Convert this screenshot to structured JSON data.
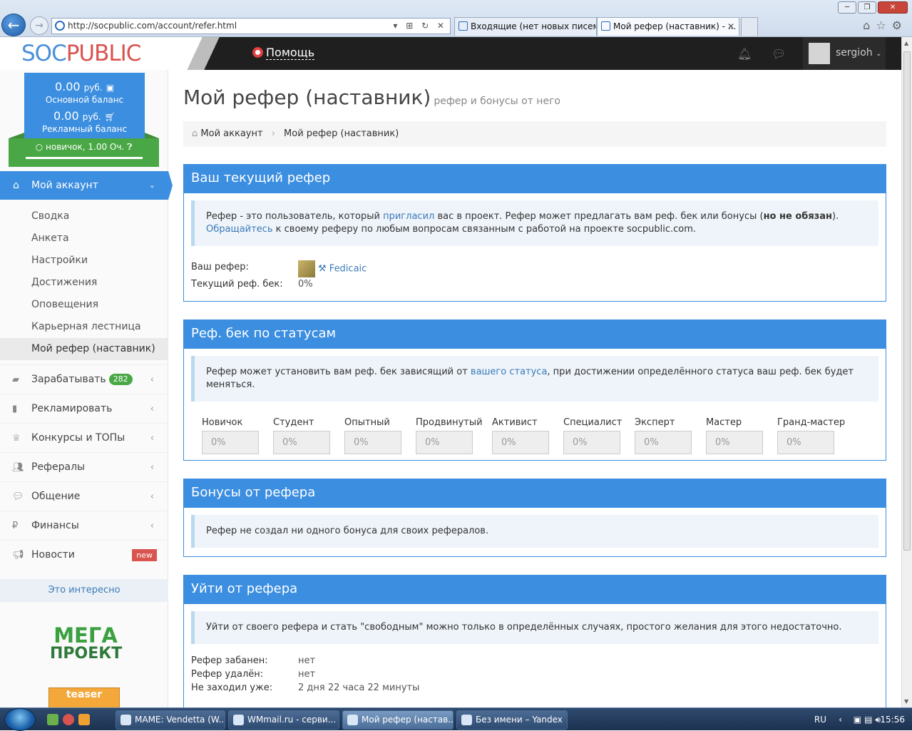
{
  "browser": {
    "url": "http://socpublic.com/account/refer.html",
    "tabs": [
      {
        "label": "Входящие (нет новых писем)..."
      },
      {
        "label": "Мой рефер (наставник) - ..."
      }
    ]
  },
  "topbar": {
    "logo_left": "SOC",
    "logo_right": "PUBLIC",
    "help": "Помощь",
    "username": "sergioh"
  },
  "sidebar": {
    "main_balance": "0.00",
    "currency": "руб.",
    "main_balance_label": "Основной баланс",
    "ad_balance": "0.00",
    "ad_balance_label": "Рекламный баланс",
    "rank": "новичок, 1.00 Оч.",
    "account_menu": "Мой аккаунт",
    "sub_items": [
      "Сводка",
      "Анкета",
      "Настройки",
      "Достижения",
      "Оповещения",
      "Карьерная лестница",
      "Мой рефер (наставник)"
    ],
    "menu": [
      {
        "label": "Зарабатывать",
        "badge": "282"
      },
      {
        "label": "Рекламировать"
      },
      {
        "label": "Конкурсы и ТОПы"
      },
      {
        "label": "Рефералы"
      },
      {
        "label": "Общение"
      },
      {
        "label": "Финансы"
      },
      {
        "label": "Новости",
        "badge": "new"
      }
    ],
    "interesting": "Это интересно",
    "mega1": "МЕГА",
    "mega2": "ПРОЕКТ",
    "teaser": "teaser"
  },
  "main": {
    "title": "Мой рефер (наставник)",
    "subtitle": "рефер и бонусы от него",
    "breadcrumb": [
      "Мой аккаунт",
      "Мой рефер (наставник)"
    ],
    "current": {
      "header": "Ваш текущий рефер",
      "note_a": "Рефер - это пользователь, который ",
      "note_link1": "пригласил",
      "note_b": " вас в проект. Рефер может предлагать вам реф. бек или бонусы (",
      "note_bold": "но не обязан",
      "note_c": "). ",
      "note_link2": "Обращайтесь",
      "note_d": " к своему реферу по любым вопросам связанным с работой на проекте socpublic.com.",
      "refer_label": "Ваш рефер:",
      "refer_name": "Fedicaic",
      "refback_label": "Текущий реф. бек:",
      "refback_value": "0%"
    },
    "statuses": {
      "header": "Реф. бек по статусам",
      "note_a": "Рефер может установить вам реф. бек зависящий от ",
      "note_link": "вашего статуса",
      "note_b": ", при достижении определённого статуса ваш реф. бек будет меняться.",
      "items": [
        {
          "label": "Новичок",
          "value": "0%"
        },
        {
          "label": "Студент",
          "value": "0%"
        },
        {
          "label": "Опытный",
          "value": "0%"
        },
        {
          "label": "Продвинутый",
          "value": "0%"
        },
        {
          "label": "Активист",
          "value": "0%"
        },
        {
          "label": "Специалист",
          "value": "0%"
        },
        {
          "label": "Эксперт",
          "value": "0%"
        },
        {
          "label": "Мастер",
          "value": "0%"
        },
        {
          "label": "Гранд-мастер",
          "value": "0%"
        }
      ]
    },
    "bonuses": {
      "header": "Бонусы от рефера",
      "note": "Рефер не создал ни одного бонуса для своих рефералов."
    },
    "leave": {
      "header": "Уйти от рефера",
      "note": "Уйти от своего рефера и стать \"свободным\" можно только в определённых случаях, простого желания для этого недостаточно.",
      "rows": [
        {
          "k": "Рефер забанен:",
          "v": "нет"
        },
        {
          "k": "Рефер удалён:",
          "v": "нет"
        },
        {
          "k": "Не заходил уже:",
          "v": "2 дня 22 часа 22 минуты"
        }
      ]
    }
  },
  "taskbar": {
    "items": [
      "MAME: Vendetta (W...",
      "WMmail.ru - серви...",
      "Мой рефер (настав...",
      "Без имени – Yandex"
    ],
    "lang": "RU",
    "clock": "15:56"
  }
}
